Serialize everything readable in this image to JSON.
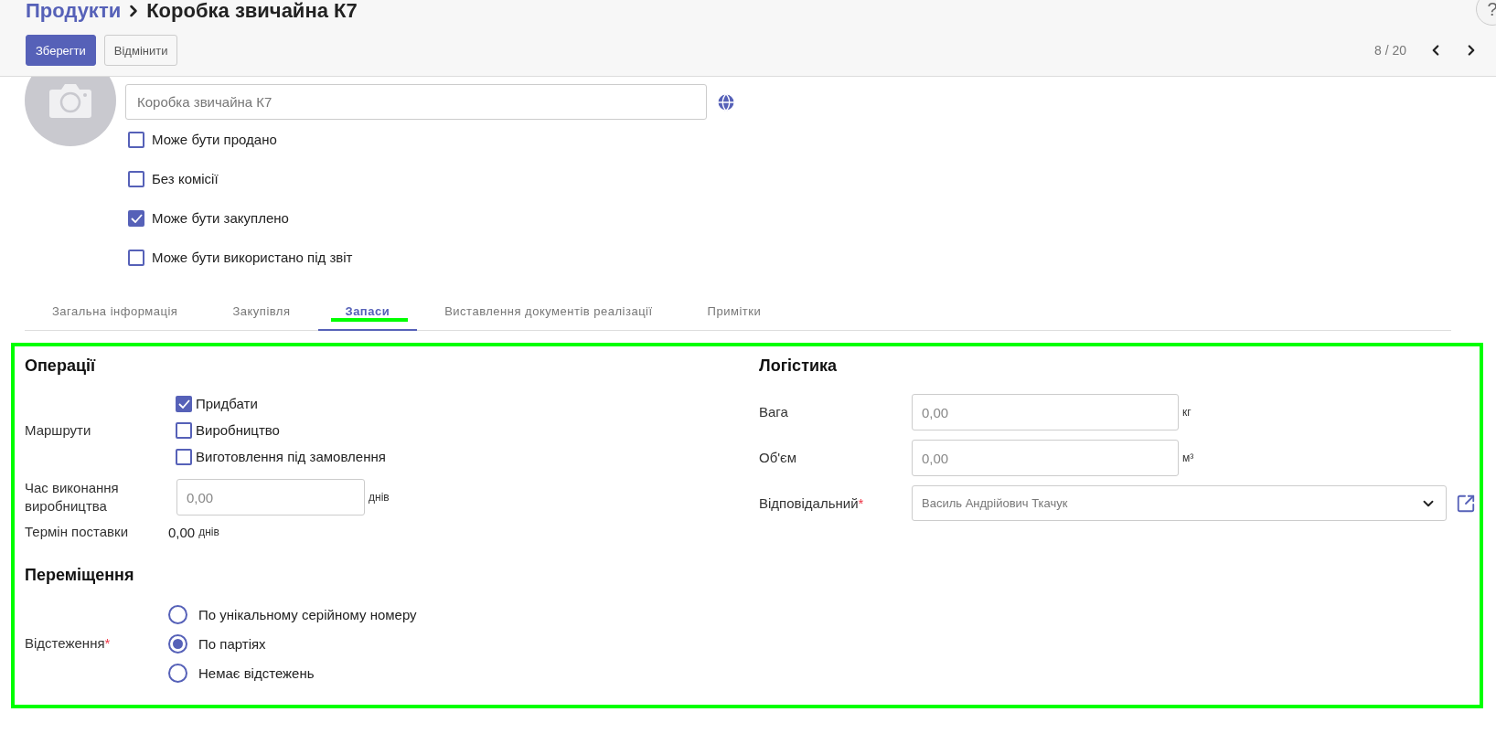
{
  "breadcrumb": {
    "parent": "Продукти",
    "current": "Коробка звичайна К7"
  },
  "help": "?",
  "actions": [
    {
      "label": "Зберегти",
      "kind": "primary"
    },
    {
      "label": "Відмінити",
      "kind": "secondary"
    }
  ],
  "pager": "8 / 20",
  "product": {
    "name": "Коробка звичайна К7",
    "flags": [
      {
        "label": "Може бути продано",
        "checked": false
      },
      {
        "label": "Без комісії",
        "checked": false
      },
      {
        "label": "Може бути закуплено",
        "checked": true
      },
      {
        "label": "Може бути використано під звіт",
        "checked": false
      }
    ]
  },
  "tabs": [
    {
      "label": "Загальна інформація",
      "selected": false
    },
    {
      "label": "Закупівля",
      "selected": false
    },
    {
      "label": "Запаси",
      "selected": true
    },
    {
      "label": "Виставлення документів реалізації",
      "selected": false
    },
    {
      "label": "Примітки",
      "selected": false
    }
  ],
  "operations": {
    "title": "Операції",
    "routes": {
      "label": "Маршрути",
      "options": [
        {
          "label": "Придбати",
          "checked": true
        },
        {
          "label": "Виробництво",
          "checked": false
        },
        {
          "label": "Виготовлення під замовлення",
          "checked": false
        }
      ]
    },
    "lead_time": {
      "label": "Час виконання виробництва",
      "value": "0,00",
      "unit": "днів"
    },
    "delivery": {
      "label": "Термін поставки",
      "value": "0,00",
      "unit": "днів"
    }
  },
  "movement": {
    "title": "Переміщення",
    "tracking": {
      "label": "Відстеження",
      "required_mark": "*",
      "options": [
        {
          "label": "По унікальному серійному номеру",
          "selected": false
        },
        {
          "label": "По партіях",
          "selected": true
        },
        {
          "label": "Немає відстежень",
          "selected": false
        }
      ]
    }
  },
  "logistics": {
    "title": "Логістика",
    "fields": [
      {
        "label": "Вага",
        "value": "0,00",
        "unit": "кг"
      },
      {
        "label": "Об'єм",
        "value": "0,00",
        "unit": "м³"
      }
    ],
    "responsible": {
      "label": "Відповідальний",
      "required_mark": "*",
      "value": "Василь Андрійович Ткачук"
    }
  }
}
